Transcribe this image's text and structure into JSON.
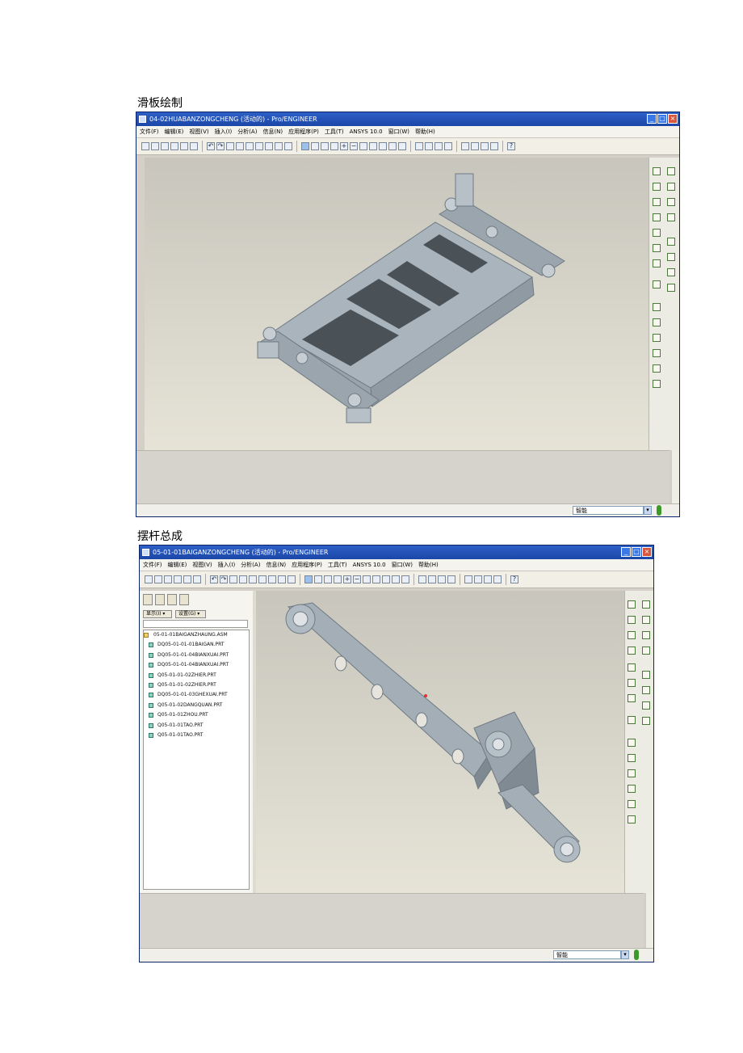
{
  "sections": [
    {
      "caption": "滑板绘制",
      "title": "04-02HUABANZONGCHENG (活动的) - Pro/ENGINEER",
      "menu": [
        "文件(F)",
        "编辑(E)",
        "视图(V)",
        "插入(I)",
        "分析(A)",
        "信息(N)",
        "应用程序(P)",
        "工具(T)",
        "ANSYS 10.0",
        "窗口(W)",
        "帮助(H)"
      ],
      "status_select": "智能"
    },
    {
      "caption": "摆杆总成",
      "title": "05-01-01BAIGANZONGCHENG (活动的) - Pro/ENGINEER",
      "menu": [
        "文件(F)",
        "编辑(E)",
        "视图(V)",
        "插入(I)",
        "分析(A)",
        "信息(N)",
        "应用程序(P)",
        "工具(T)",
        "ANSYS 10.0",
        "窗口(W)",
        "帮助(H)"
      ],
      "status_select": "智能",
      "nav_show": "显示(I) ▾",
      "nav_settings": "设置(G) ▾",
      "model_tree": [
        "05-01-01BAIGANZHAUNG.ASM",
        "DQ05-01-01-01BAIGAN.PRT",
        "DQ05-01-01-04BIANXUAI.PRT",
        "DQ05-01-01-04BIANXUAI.PRT",
        "Q05-01-01-02ZHIER.PRT",
        "Q05-01-01-02ZHIER.PRT",
        "DQ05-01-01-03GHEXUAI.PRT",
        "Q05-01-02DANGQUAN.PRT",
        "Q05-01-01ZHOU.PRT",
        "Q05-01-01TAO.PRT",
        "Q05-01-01TAO.PRT"
      ]
    }
  ],
  "icons": {
    "window_buttons": [
      "minimize-icon",
      "maximize-icon",
      "close-icon"
    ],
    "status": "traffic-light-icon"
  }
}
